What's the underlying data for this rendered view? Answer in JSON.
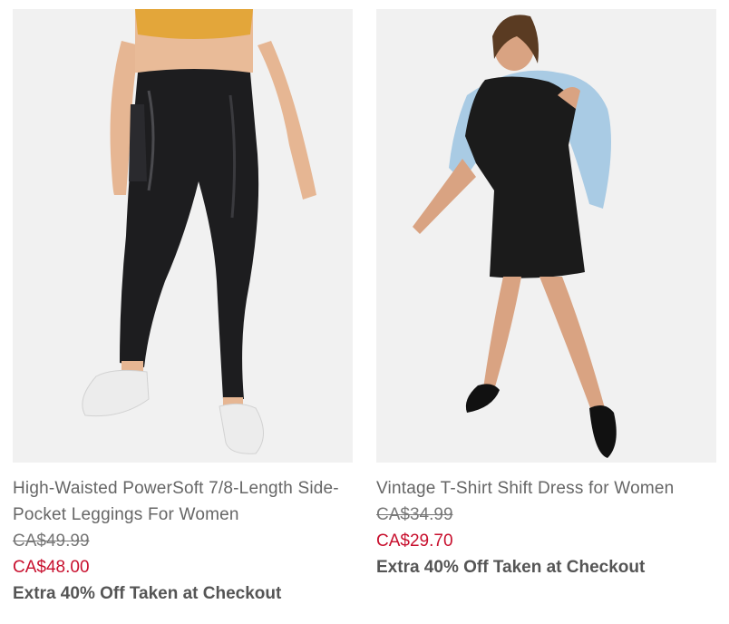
{
  "products": [
    {
      "title": "High-Waisted PowerSoft 7/8-Length Side-Pocket Leggings For Women",
      "original_price": "CA$49.99",
      "sale_price": "CA$48.00",
      "promo": "Extra 40% Off Taken at Checkout"
    },
    {
      "title": "Vintage T-Shirt Shift Dress for Women",
      "original_price": "CA$34.99",
      "sale_price": "CA$29.70",
      "promo": "Extra 40% Off Taken at Checkout"
    }
  ],
  "colors": {
    "sale": "#c8102e",
    "text": "#666666",
    "photo_bg": "#f1f1f1"
  }
}
